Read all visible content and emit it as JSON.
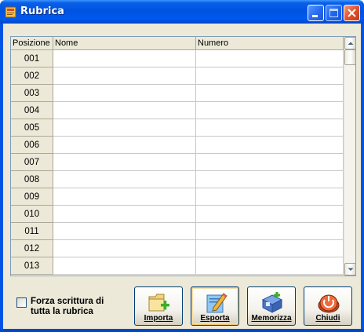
{
  "window": {
    "title": "Rubrica",
    "icon": "address-book-icon",
    "controls": [
      "minimize-icon",
      "maximize-icon",
      "close-icon"
    ]
  },
  "grid": {
    "columns": [
      "Posizione",
      "Nome",
      "Numero"
    ],
    "rows": [
      {
        "pos": "001",
        "nome": "",
        "numero": ""
      },
      {
        "pos": "002",
        "nome": "",
        "numero": ""
      },
      {
        "pos": "003",
        "nome": "",
        "numero": ""
      },
      {
        "pos": "004",
        "nome": "",
        "numero": ""
      },
      {
        "pos": "005",
        "nome": "",
        "numero": ""
      },
      {
        "pos": "006",
        "nome": "",
        "numero": ""
      },
      {
        "pos": "007",
        "nome": "",
        "numero": ""
      },
      {
        "pos": "008",
        "nome": "",
        "numero": ""
      },
      {
        "pos": "009",
        "nome": "",
        "numero": ""
      },
      {
        "pos": "010",
        "nome": "",
        "numero": ""
      },
      {
        "pos": "011",
        "nome": "",
        "numero": ""
      },
      {
        "pos": "012",
        "nome": "",
        "numero": ""
      },
      {
        "pos": "013",
        "nome": "",
        "numero": ""
      }
    ]
  },
  "options": {
    "force_write_label_line1": "Forza scrittura di",
    "force_write_label_line2": "tutta la rubrica",
    "force_write_checked": false
  },
  "buttons": {
    "import": {
      "label": "Importa",
      "icon": "folder-add-icon"
    },
    "export": {
      "label": "Esporta",
      "icon": "pencil-note-icon"
    },
    "save": {
      "label": "Memorizza",
      "icon": "floppy-save-icon"
    },
    "close": {
      "label": "Chiudi",
      "icon": "power-icon"
    }
  }
}
